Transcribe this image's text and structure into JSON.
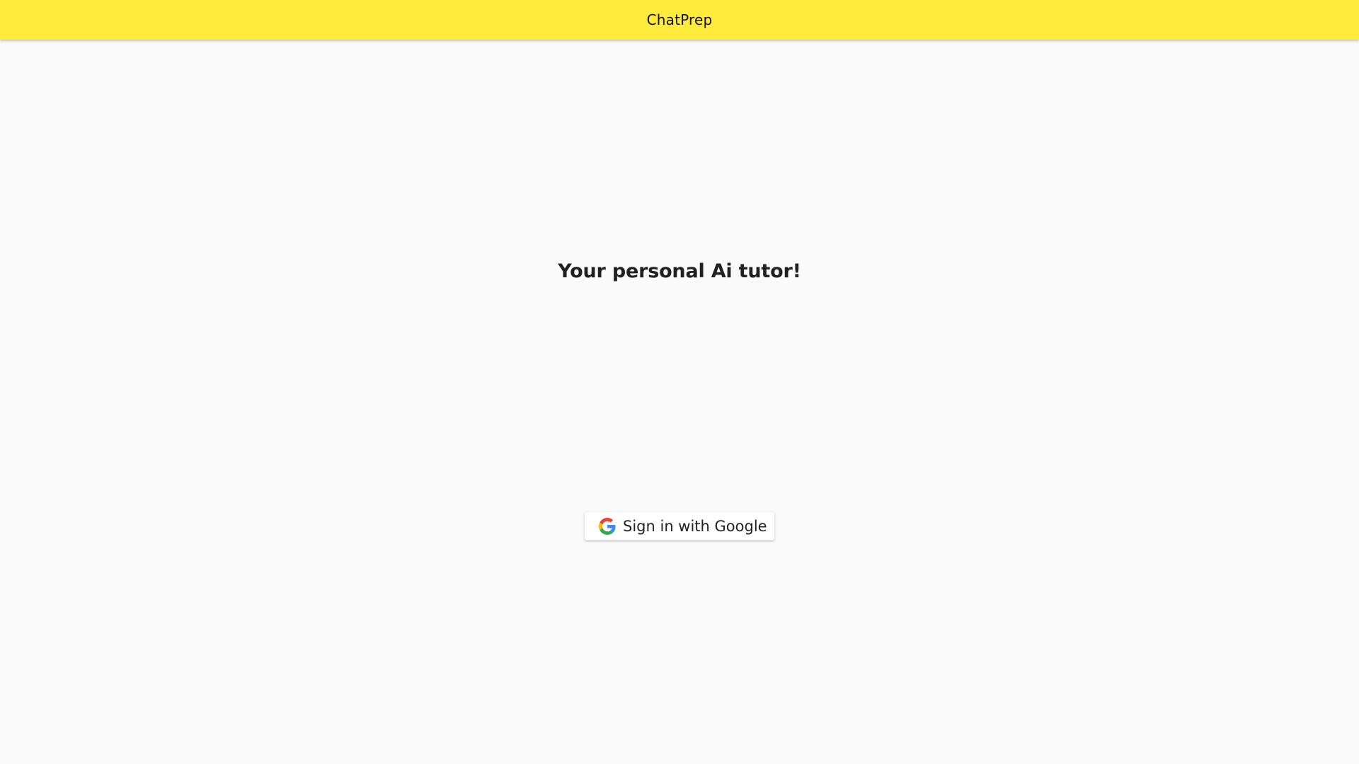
{
  "app_bar": {
    "title": "ChatPrep",
    "background": "#ffeb3b"
  },
  "main": {
    "headline": "Your personal Ai tutor!",
    "sign_in_button": {
      "label": "Sign in with Google",
      "icon": "google-g-icon"
    }
  },
  "colors": {
    "page_background": "#fafafa",
    "text": "#212121"
  }
}
